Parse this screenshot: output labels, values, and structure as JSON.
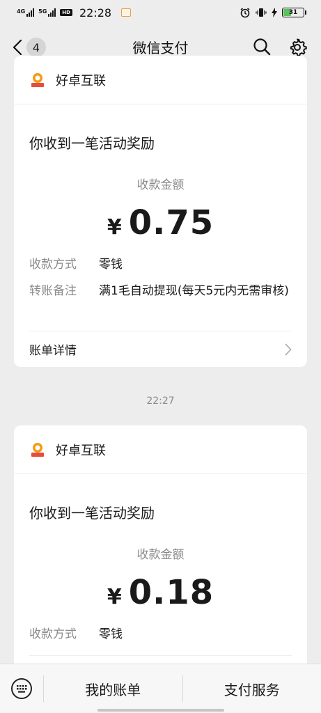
{
  "status_bar": {
    "net1": "4G",
    "net2": "5G",
    "hd": "HD",
    "time": "22:28",
    "battery": "31",
    "battery_color": "#5cc25c"
  },
  "nav": {
    "badge": "4",
    "title": "微信支付"
  },
  "messages": [
    {
      "merchant": "好卓互联",
      "headline": "你收到一笔活动奖励",
      "amount_label": "收款金额",
      "currency": "¥",
      "amount": "0.75",
      "method_label": "收款方式",
      "method_value": "零钱",
      "remark_label": "转账备注",
      "remark_value": "满1毛自动提现(每天5元内无需审核)",
      "detail": "账单详情"
    },
    {
      "merchant": "好卓互联",
      "headline": "你收到一笔活动奖励",
      "amount_label": "收款金额",
      "currency": "¥",
      "amount": "0.18",
      "method_label": "收款方式",
      "method_value": "零钱"
    }
  ],
  "time_separator": "22:27",
  "bottom_bar": {
    "tab1": "我的账单",
    "tab2": "支付服务"
  },
  "icons": {
    "back": "chevron-left-icon",
    "search": "search-icon",
    "settings": "gear-icon",
    "keyboard": "keyboard-icon",
    "chevron": "chevron-right-icon"
  }
}
